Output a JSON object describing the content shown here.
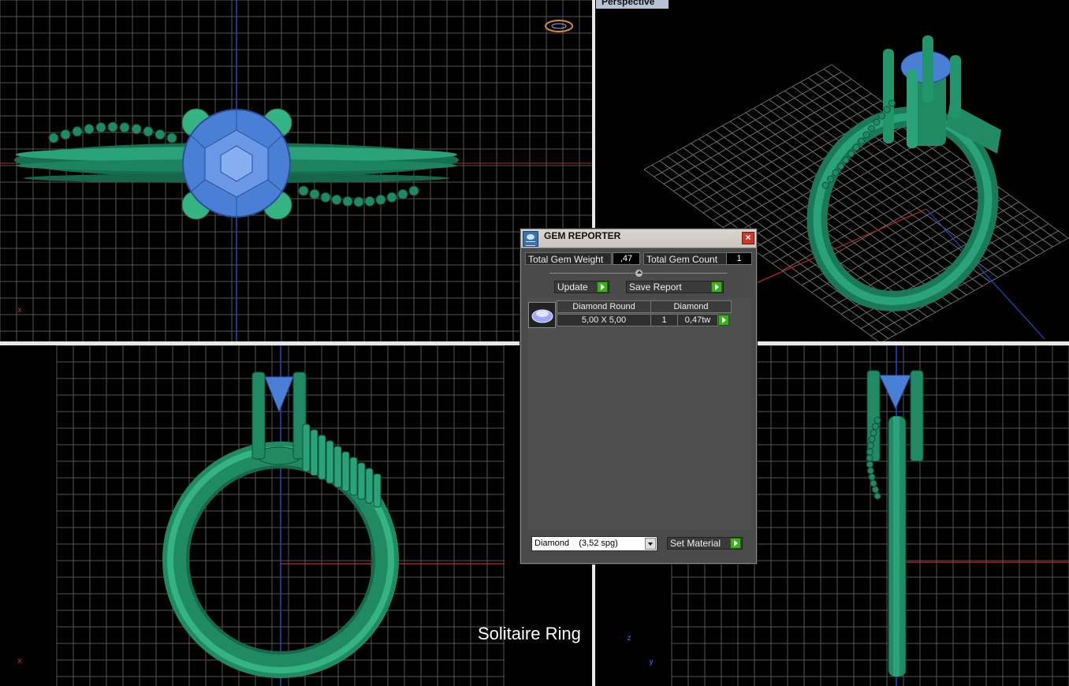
{
  "viewports": {
    "perspective_label": "Perspective",
    "caption": "Solitaire Ring",
    "axis_x": "x",
    "axis_z": "z",
    "axis_y": "y"
  },
  "gem_reporter": {
    "title": "GEM REPORTER",
    "close_glyph": "×",
    "total_gem_weight_label": "Total Gem Weight",
    "total_gem_weight_value": ",47",
    "total_gem_count_label": "Total Gem Count",
    "total_gem_count_value": "1",
    "update_label": "Update",
    "save_report_label": "Save Report",
    "gems": [
      {
        "shape": "Diamond Round",
        "material": "Diamond",
        "size": "5,00 X 5,00",
        "count": "1",
        "weight": "0,47tw"
      }
    ],
    "material_select_value": "Diamond    (3,52 spg)",
    "set_material_label": "Set Material"
  },
  "colors": {
    "metal": "#1f8a64",
    "metal_light": "#36b383",
    "gem": "#4a7fd6",
    "grid": "#5a5a5a",
    "axis_red": "#c0282a",
    "axis_blue": "#2646c8"
  }
}
